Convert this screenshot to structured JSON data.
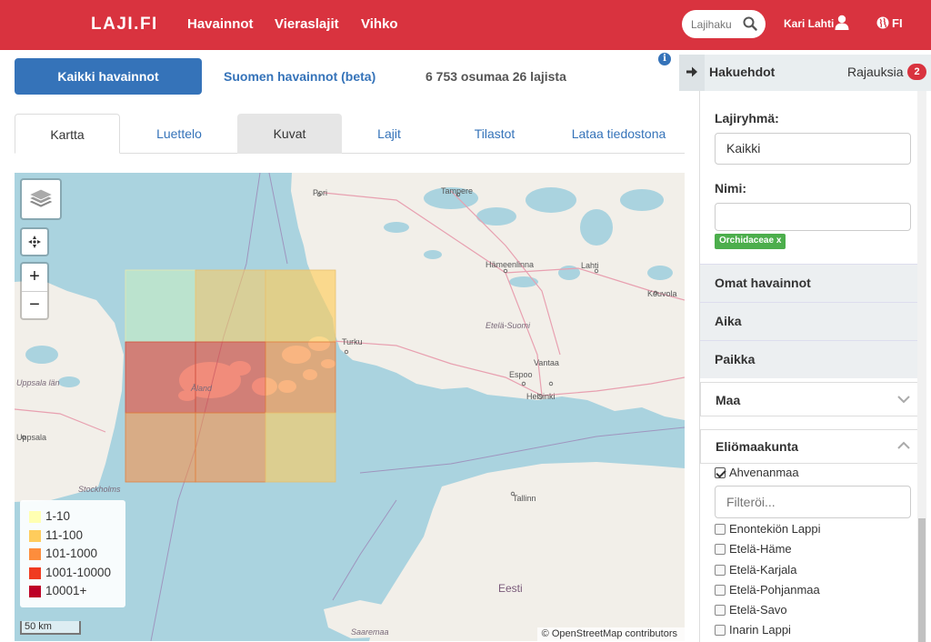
{
  "navbar": {
    "brand": "LAJI.FI",
    "links": [
      "Havainnot",
      "Vieraslajit",
      "Vihko"
    ],
    "search_placeholder": "Lajihaku",
    "user": "Kari Lahti",
    "language": "FI",
    "color": "#d9333f"
  },
  "source": {
    "all_label": "Kaikki havainnot",
    "finnish_label": "Suomen havainnot (beta)",
    "count_text": "6 753 osumaa 26 lajista",
    "info": "i"
  },
  "tabs": [
    {
      "label": "Kartta",
      "state": "active"
    },
    {
      "label": "Luettelo",
      "state": "normal"
    },
    {
      "label": "Kuvat",
      "state": "hover"
    },
    {
      "label": "Lajit",
      "state": "normal"
    },
    {
      "label": "Tilastot",
      "state": "normal"
    },
    {
      "label": "Lataa tiedostona",
      "state": "normal"
    }
  ],
  "map": {
    "legend": [
      {
        "label": "1-10",
        "color": "#ffffb2"
      },
      {
        "label": "11-100",
        "color": "#fecc5c"
      },
      {
        "label": "101-1000",
        "color": "#fd8d3c"
      },
      {
        "label": "1001-10000",
        "color": "#f03b20"
      },
      {
        "label": "10001+",
        "color": "#bd0026"
      }
    ],
    "scale": "50 km",
    "attribution": "© OpenStreetMap contributors",
    "labels": {
      "pori": "Pori",
      "tampere": "Tampere",
      "hameenlinna": "Hämeenlinna",
      "lahti": "Lahti",
      "kouvola": "Kouvola",
      "turku": "Turku",
      "etela_suomi": "Etelä-Suomi",
      "espoo": "Espoo",
      "vantaa": "Vantaa",
      "helsinki": "Helsinki",
      "aland": "Åland",
      "uppsala_lan": "Uppsala län",
      "uppsala": "Uppsala",
      "stockholms": "Stockholms",
      "tallinn": "Tallinn",
      "eesti": "Eesti",
      "saaremaa": "Saaremaa"
    }
  },
  "panel": {
    "title": "Hakuehdot",
    "rajauksia": "Rajauksia",
    "rajauksia_count": "2",
    "lajiryhma_label": "Lajiryhmä:",
    "lajiryhma_value": "Kaikki",
    "nimi_label": "Nimi:",
    "nimi_value": "",
    "chip": "Orchidaceae x",
    "sections": [
      "Omat havainnot",
      "Aika",
      "Paikka"
    ],
    "maa": "Maa",
    "eliomaakunta": "Eliömaakunta",
    "filter_placeholder": "Filteröi...",
    "checked_item": "Ahvenanmaa",
    "items": [
      "Enontekiön Lappi",
      "Etelä-Häme",
      "Etelä-Karjala",
      "Etelä-Pohjanmaa",
      "Etelä-Savo",
      "Inarin Lappi"
    ]
  }
}
